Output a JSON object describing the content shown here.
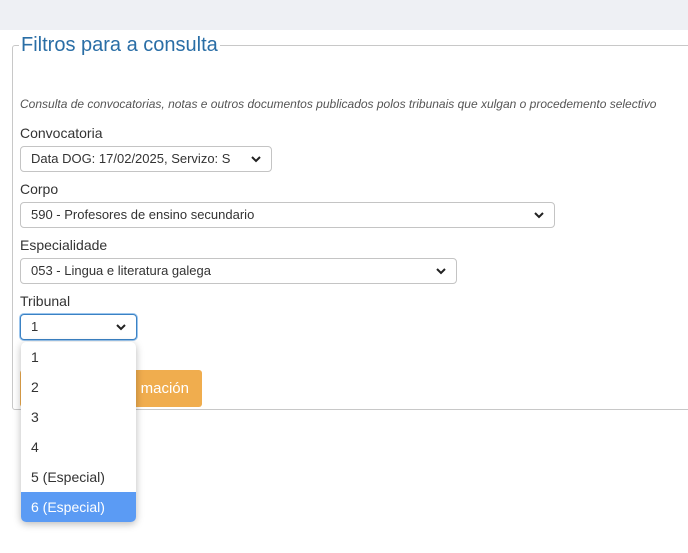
{
  "page": {
    "legend": "Filtros para a consulta",
    "description": "Consulta de convocatorias, notas e outros documentos publicados polos tribunais que xulgan o procedemento selectivo"
  },
  "filters": {
    "convocatoria": {
      "label": "Convocatoria",
      "value": "Data DOG: 17/02/2025, Servizo: S"
    },
    "corpo": {
      "label": "Corpo",
      "value": "590 - Profesores de ensino secundario"
    },
    "especialidade": {
      "label": "Especialidade",
      "value": "053 - Lingua e literatura galega"
    },
    "tribunal": {
      "label": "Tribunal",
      "value": "1",
      "options": [
        "1",
        "2",
        "3",
        "4",
        "5  (Especial)",
        "6  (Especial)"
      ],
      "highlighted_option": "6  (Especial)"
    }
  },
  "actions": {
    "info_button_label": "Ver información",
    "info_button_visible": "mación"
  },
  "colors": {
    "accent": "#2a6ea6",
    "button": "#f0ad4e",
    "highlight": "#5b9bf4"
  },
  "icons": {
    "select_chevron": "chevron-down-icon"
  }
}
